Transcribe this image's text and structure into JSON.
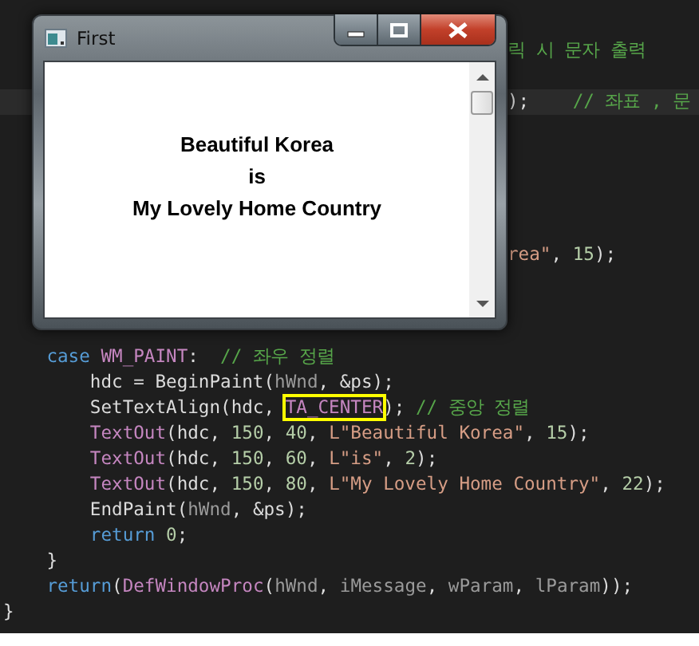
{
  "editor": {
    "lines": [
      {
        "kind": "blank"
      },
      {
        "kind": "blank"
      },
      {
        "kind": "partial",
        "segments": [
          {
            "text": "릭 시 문자 출력",
            "kind": "comment"
          }
        ]
      },
      {
        "kind": "blank"
      },
      {
        "kind": "partial",
        "current": true,
        "segments": [
          {
            "text": ");    "
          },
          {
            "text": "// 좌표 , 문",
            "kind": "comment"
          }
        ]
      },
      {
        "kind": "blank"
      },
      {
        "kind": "blank"
      },
      {
        "kind": "blank"
      },
      {
        "kind": "blank"
      },
      {
        "kind": "blank"
      },
      {
        "kind": "partial",
        "segments": [
          {
            "text": "rea\"",
            "kind": "string"
          },
          {
            "text": ", "
          },
          {
            "text": "15",
            "kind": "number"
          },
          {
            "text": ");"
          }
        ]
      },
      {
        "kind": "blank"
      },
      {
        "kind": "blank"
      },
      {
        "kind": "blank"
      },
      {
        "kind": "code",
        "segments": [
          {
            "text": "    case ",
            "kind": "keyword"
          },
          {
            "text": "WM_PAINT",
            "kind": "macro"
          },
          {
            "text": ":  "
          },
          {
            "text": "// 좌우 정렬",
            "kind": "comment"
          }
        ]
      },
      {
        "kind": "code",
        "segments": [
          {
            "text": "        hdc = BeginPaint("
          },
          {
            "text": "hWnd",
            "kind": "param"
          },
          {
            "text": ", &ps);"
          }
        ]
      },
      {
        "kind": "code",
        "segments": [
          {
            "text": "        SetTextAlign(hdc, "
          },
          {
            "text": "TA_CENTER",
            "kind": "macro",
            "boxed": true
          },
          {
            "text": "); "
          },
          {
            "text": "// 중앙 정렬",
            "kind": "comment"
          }
        ]
      },
      {
        "kind": "code",
        "segments": [
          {
            "text": "        TextOut",
            "kind": "macro"
          },
          {
            "text": "(hdc, "
          },
          {
            "text": "150",
            "kind": "number"
          },
          {
            "text": ", "
          },
          {
            "text": "40",
            "kind": "number"
          },
          {
            "text": ", "
          },
          {
            "text": "L\"Beautiful Korea\"",
            "kind": "string"
          },
          {
            "text": ", "
          },
          {
            "text": "15",
            "kind": "number"
          },
          {
            "text": ");"
          }
        ]
      },
      {
        "kind": "code",
        "segments": [
          {
            "text": "        TextOut",
            "kind": "macro"
          },
          {
            "text": "(hdc, "
          },
          {
            "text": "150",
            "kind": "number"
          },
          {
            "text": ", "
          },
          {
            "text": "60",
            "kind": "number"
          },
          {
            "text": ", "
          },
          {
            "text": "L\"is\"",
            "kind": "string"
          },
          {
            "text": ", "
          },
          {
            "text": "2",
            "kind": "number"
          },
          {
            "text": ");"
          }
        ]
      },
      {
        "kind": "code",
        "segments": [
          {
            "text": "        TextOut",
            "kind": "macro"
          },
          {
            "text": "(hdc, "
          },
          {
            "text": "150",
            "kind": "number"
          },
          {
            "text": ", "
          },
          {
            "text": "80",
            "kind": "number"
          },
          {
            "text": ", "
          },
          {
            "text": "L\"My Lovely Home Country\"",
            "kind": "string"
          },
          {
            "text": ", "
          },
          {
            "text": "22",
            "kind": "number"
          },
          {
            "text": ");"
          }
        ]
      },
      {
        "kind": "code",
        "segments": [
          {
            "text": "        EndPaint("
          },
          {
            "text": "hWnd",
            "kind": "param"
          },
          {
            "text": ", &ps);"
          }
        ]
      },
      {
        "kind": "code",
        "segments": [
          {
            "text": "        return ",
            "kind": "keyword"
          },
          {
            "text": "0",
            "kind": "number"
          },
          {
            "text": ";"
          }
        ]
      },
      {
        "kind": "code",
        "segments": [
          {
            "text": "    }"
          }
        ]
      },
      {
        "kind": "code",
        "segments": [
          {
            "text": "    return",
            "kind": "keyword"
          },
          {
            "text": "("
          },
          {
            "text": "DefWindowProc",
            "kind": "macro"
          },
          {
            "text": "("
          },
          {
            "text": "hWnd",
            "kind": "param"
          },
          {
            "text": ", "
          },
          {
            "text": "iMessage",
            "kind": "param"
          },
          {
            "text": ", "
          },
          {
            "text": "wParam",
            "kind": "param"
          },
          {
            "text": ", "
          },
          {
            "text": "lParam",
            "kind": "param"
          },
          {
            "text": "));"
          }
        ]
      },
      {
        "kind": "code",
        "segments": [
          {
            "text": "}"
          }
        ]
      }
    ]
  },
  "window": {
    "title": "First",
    "lines": [
      "Beautiful Korea",
      "is",
      "My Lovely Home Country"
    ]
  }
}
